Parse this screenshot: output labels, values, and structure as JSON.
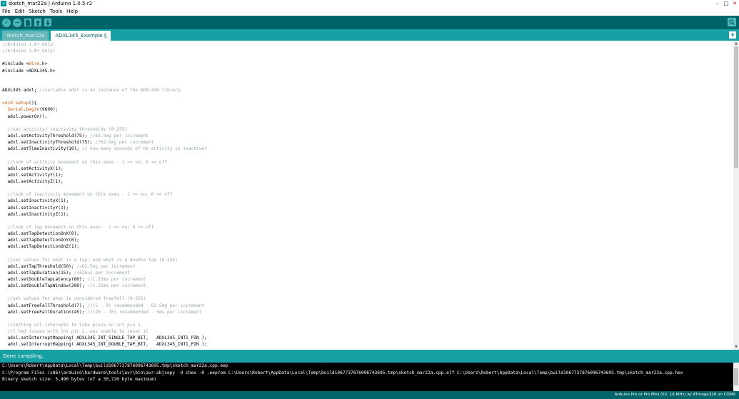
{
  "window": {
    "title": "sketch_mar22a | Arduino 1.0.5-r2",
    "icon_label": "∞"
  },
  "menu": [
    "File",
    "Edit",
    "Sketch",
    "Tools",
    "Help"
  ],
  "toolbar": {
    "verify_icon": "✓",
    "upload_icon": "→",
    "new_icon": "new-icon",
    "open_icon": "open-icon",
    "save_icon": "save-icon",
    "search_icon": "magnifier-icon"
  },
  "tabs": [
    {
      "label": "sketch_mar22a",
      "active": false
    },
    {
      "label": "ADXL345_Example §",
      "active": true
    }
  ],
  "code": [
    [
      [
        "cm",
        "//Arduino 1.0+ Only!"
      ]
    ],
    [
      [
        "cm",
        "//Arduino 1.0+ Only!"
      ]
    ],
    [
      [
        "id",
        ""
      ]
    ],
    [
      [
        "id",
        "#include <"
      ],
      [
        "lib",
        "Wire"
      ],
      [
        "id",
        ".h>"
      ]
    ],
    [
      [
        "id",
        "#include <ADXL345.h>"
      ]
    ],
    [
      [
        "id",
        ""
      ]
    ],
    [
      [
        "id",
        ""
      ]
    ],
    [
      [
        "id",
        "ADXL345 adxl; "
      ],
      [
        "cm",
        "//variable adxl is an instance of the ADXL345 library"
      ]
    ],
    [
      [
        "id",
        ""
      ]
    ],
    [
      [
        "kw",
        "void"
      ],
      [
        "id",
        " "
      ],
      [
        "kw",
        "setup"
      ],
      [
        "id",
        "(){"
      ]
    ],
    [
      [
        "id",
        "  "
      ],
      [
        "kw",
        "Serial"
      ],
      [
        "id",
        "."
      ],
      [
        "kw",
        "begin"
      ],
      [
        "id",
        "(9600);"
      ]
    ],
    [
      [
        "id",
        "  adxl.powerOn();"
      ]
    ],
    [
      [
        "id",
        ""
      ]
    ],
    [
      [
        "id",
        "  "
      ],
      [
        "cm",
        "//set activity/ inactivity thresholds (0-255)"
      ]
    ],
    [
      [
        "id",
        "  adxl.setActivityThreshold(75); "
      ],
      [
        "cm",
        "//62.5mg per increment"
      ]
    ],
    [
      [
        "id",
        "  adxl.setInactivityThreshold(75); "
      ],
      [
        "cm",
        "//62.5mg per increment"
      ]
    ],
    [
      [
        "id",
        "  adxl.setTimeInactivity(10); "
      ],
      [
        "cm",
        "// how many seconds of no activity is inactive?"
      ]
    ],
    [
      [
        "id",
        ""
      ]
    ],
    [
      [
        "id",
        "  "
      ],
      [
        "cm",
        "//look of activity movement on this axes - 1 == on; 0 == off"
      ]
    ],
    [
      [
        "id",
        "  adxl.setActivityX(1);"
      ]
    ],
    [
      [
        "id",
        "  adxl.setActivityY(1);"
      ]
    ],
    [
      [
        "id",
        "  adxl.setActivityZ(1);"
      ]
    ],
    [
      [
        "id",
        ""
      ]
    ],
    [
      [
        "id",
        "  "
      ],
      [
        "cm",
        "//look of inactivity movement on this axes - 1 == on; 0 == off"
      ]
    ],
    [
      [
        "id",
        "  adxl.setInactivityX(1);"
      ]
    ],
    [
      [
        "id",
        "  adxl.setInactivityY(1);"
      ]
    ],
    [
      [
        "id",
        "  adxl.setInactivityZ(1);"
      ]
    ],
    [
      [
        "id",
        ""
      ]
    ],
    [
      [
        "id",
        "  "
      ],
      [
        "cm",
        "//look of tap movement on this axes - 1 == on; 0 == off"
      ]
    ],
    [
      [
        "id",
        "  adxl.setTapDetectionOnX(0);"
      ]
    ],
    [
      [
        "id",
        "  adxl.setTapDetectionOnY(0);"
      ]
    ],
    [
      [
        "id",
        "  adxl.setTapDetectionOnZ(1);"
      ]
    ],
    [
      [
        "id",
        ""
      ]
    ],
    [
      [
        "id",
        "  "
      ],
      [
        "cm",
        "//set values for what is a tap, and what is a double tap (0-255)"
      ]
    ],
    [
      [
        "id",
        "  adxl.setTapThreshold(50); "
      ],
      [
        "cm",
        "//62.5mg per increment"
      ]
    ],
    [
      [
        "id",
        "  adxl.setTapDuration(15); "
      ],
      [
        "cm",
        "//625us per increment"
      ]
    ],
    [
      [
        "id",
        "  adxl.setDoubleTapLatency(80); "
      ],
      [
        "cm",
        "//1.25ms per increment"
      ]
    ],
    [
      [
        "id",
        "  adxl.setDoubleTapWindow(200); "
      ],
      [
        "cm",
        "//1.25ms per increment"
      ]
    ],
    [
      [
        "id",
        ""
      ]
    ],
    [
      [
        "id",
        "  "
      ],
      [
        "cm",
        "//set values for what is considered freefall (0-255)"
      ]
    ],
    [
      [
        "id",
        "  adxl.setFreeFallThreshold(7); "
      ],
      [
        "cm",
        "//(5 - 9) recommended - 62.5mg per increment"
      ]
    ],
    [
      [
        "id",
        "  adxl.setFreeFallDuration(45); "
      ],
      [
        "cm",
        "//(20 - 70) recommended - 5ms per increment"
      ]
    ],
    [
      [
        "id",
        ""
      ]
    ],
    [
      [
        "id",
        "  "
      ],
      [
        "cm",
        "//setting all interupts to take place on int pin 1"
      ]
    ],
    [
      [
        "id",
        "  "
      ],
      [
        "cm",
        "//I had issues with int pin 2, was unable to reset it"
      ]
    ],
    [
      [
        "id",
        "  adxl.setInterruptMapping( ADXL345_INT_SINGLE_TAP_BIT,   ADXL345_INT1_PIN );"
      ]
    ],
    [
      [
        "id",
        "  adxl.setInterruptMapping( ADXL345_INT_DOUBLE_TAP_BIT,   ADXL345_INT1_PIN );"
      ]
    ]
  ],
  "status": {
    "message": "Done compiling."
  },
  "console": [
    "C:\\Users\\Robert\\AppData\\Local\\Temp\\build1067737876096743695.tmp\\sketch_mar22a.cpp.eep",
    "C:\\Program Files (x86)\\arduino\\hardware\\tools\\avr\\bin\\avr-objcopy -O ihex -R .eeprom C:\\Users\\Robert\\AppData\\Local\\Temp\\build1067737876096743695.tmp\\sketch_mar22a.cpp.elf C:\\Users\\Robert\\AppData\\Local\\Temp\\build1067737876096743695.tmp\\sketch_mar22a.cpp.hex",
    "Binary sketch size: 5,496 bytes (of a 30,720 byte maximum)"
  ],
  "board_info": "Arduino Pro or Pro Mini (5V, 16 MHz) w/ ATmega328 on COM9",
  "colors": {
    "toolbar": "#006468",
    "tabbar": "#17a1a5",
    "comment": "#95a5a6",
    "keyword": "#d35400"
  }
}
